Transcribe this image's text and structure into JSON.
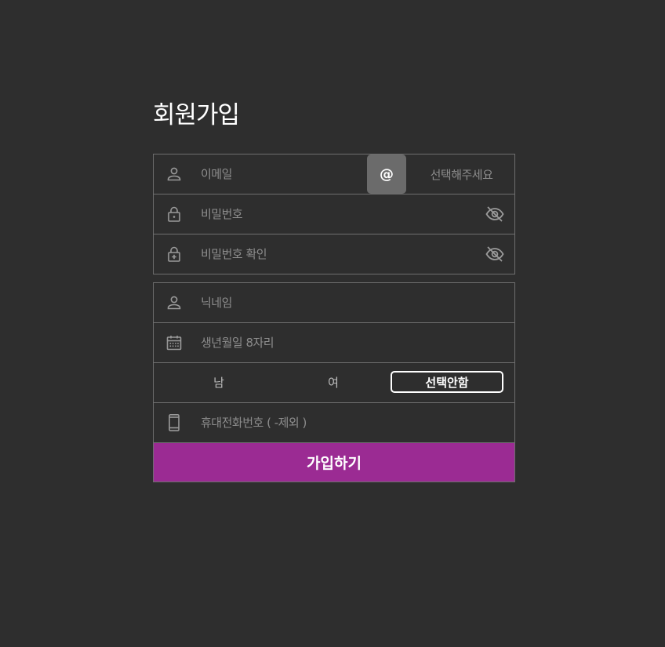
{
  "page": {
    "title": "회원가입"
  },
  "account": {
    "email": {
      "placeholder": "이메일",
      "value": "",
      "icon": "user-icon"
    },
    "at_label": "@",
    "domain_select": {
      "selected": "선택해주세요"
    },
    "password": {
      "placeholder": "비밀번호",
      "value": "",
      "icon": "lock-icon",
      "toggle_icon": "eye-off-icon"
    },
    "password_confirm": {
      "placeholder": "비밀번호 확인",
      "value": "",
      "icon": "lock-plus-icon",
      "toggle_icon": "eye-off-icon"
    }
  },
  "profile": {
    "nickname": {
      "placeholder": "닉네임",
      "value": "",
      "icon": "user-icon"
    },
    "birthdate": {
      "placeholder": "생년월일 8자리",
      "value": "",
      "icon": "calendar-icon"
    },
    "gender": {
      "options": [
        "남",
        "여",
        "선택안함"
      ],
      "selected": "선택안함"
    },
    "phone": {
      "placeholder": "휴대전화번호 ( -제외 )",
      "value": "",
      "icon": "mobile-phone-icon"
    }
  },
  "submit_label": "가입하기",
  "colors": {
    "background": "#2e2e2e",
    "border": "#6f6f6f",
    "accent": "#9b2b93",
    "at_button": "#6b6b6b",
    "placeholder": "#8d8d8d"
  }
}
